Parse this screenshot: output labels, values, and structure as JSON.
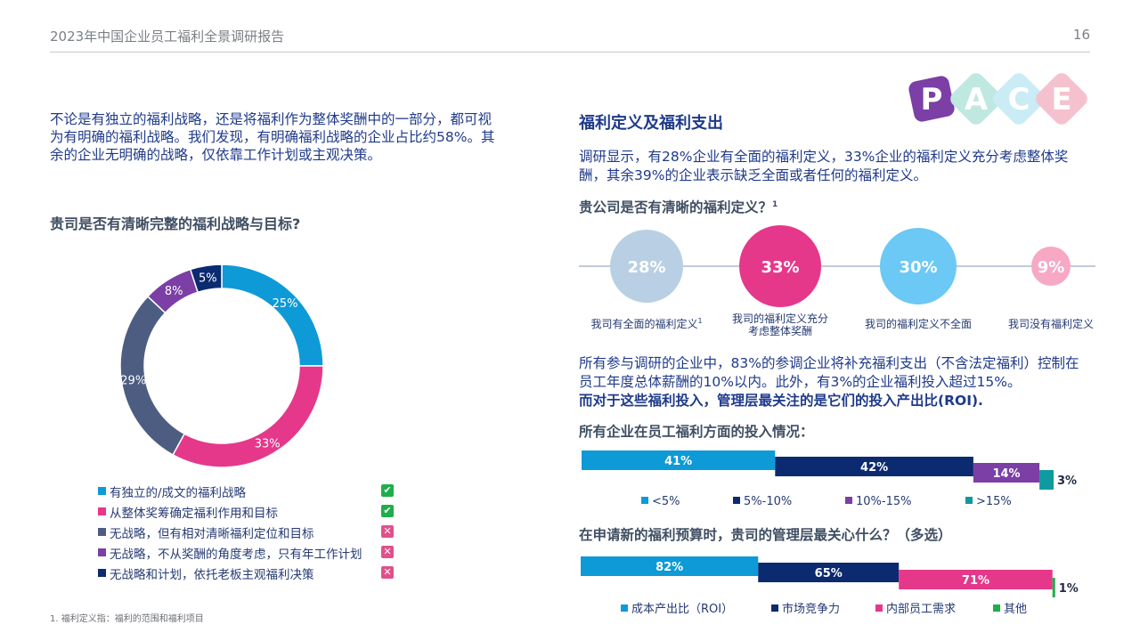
{
  "header": {
    "title": "2023年中国企业员工福利全景调研报告",
    "page": "16"
  },
  "left": {
    "intro": "不论是有独立的福利战略，还是将福利作为整体奖酬中的一部分，都可视为有明确的福利战略。我们发现，有明确福利战略的企业占比约58%。其余的企业无明确的战略，仅依靠工作计划或主观决策。",
    "question": "贵司是否有清晰完整的福利战略与目标?",
    "footnote": "1. 福利定义指：福利的范围和福利项目"
  },
  "pace": {
    "letters": [
      "P",
      "A",
      "C",
      "E"
    ],
    "colors": [
      "#7b3fa6",
      "#bfe8e0",
      "#c9ecf5",
      "#f6c1cf"
    ]
  },
  "right": {
    "heading": "福利定义及福利支出",
    "para1": "调研显示，有28%企业有全面的福利定义，33%企业的福利定义充分考虑整体奖酬，其余39%的企业表示缺乏全面或者任何的福利定义。",
    "q_def": "贵公司是否有清晰的福利定义？",
    "q_def_sup": "1",
    "para2": "所有参与调研的企业中，83%的参调企业将补充福利支出（不含法定福利）控制在员工年度总体薪酬的10%以内。此外，有3%的企业福利投入超过15%。",
    "para2_bold": "而对于这些福利投入，管理层最关注的是它们的投入产出比(ROI).",
    "q_invest": "所有企业在员工福利方面的投入情况：",
    "q_budget": "在申请新的福利预算时，贵司的管理层最关心什么？（多选）"
  },
  "chart_data": [
    {
      "type": "pie",
      "title": "贵司是否有清晰完整的福利战略与目标?",
      "categories": [
        "有独立的/成文的福利战略",
        "从整体奖筹确定福利作用和目标",
        "无战略，但有相对清晰福利定位和目标",
        "无战略，不从奖酬的角度考虑，只有年工作计划",
        "无战略和计划，依托老板主观福利决策"
      ],
      "values": [
        25,
        33,
        29,
        8,
        5
      ],
      "labels": [
        "25%",
        "33%",
        "29%",
        "8%",
        "5%"
      ],
      "colors": [
        "#0e9ad7",
        "#e5388b",
        "#4d5d82",
        "#7b3fa6",
        "#0b2a6f"
      ],
      "has_strategy": [
        true,
        true,
        false,
        false,
        false
      ],
      "donut": true,
      "legend": "bottom"
    },
    {
      "type": "bubble",
      "title": "贵公司是否有清晰的福利定义？",
      "categories": [
        "我司有全面的福利定义",
        "我司的福利定义充分考虑整体奖酬",
        "我司的福利定义不全面",
        "我司没有福利定义"
      ],
      "category_lines": [
        [
          "我司有全面的福利定义"
        ],
        [
          "我司的福利定义充分",
          "考虑整体奖酬"
        ],
        [
          "我司的福利定义不全面"
        ],
        [
          "我司没有福利定义"
        ]
      ],
      "category_sup": [
        "1",
        "",
        "",
        ""
      ],
      "values": [
        28,
        33,
        30,
        9
      ],
      "labels": [
        "28%",
        "33%",
        "30%",
        "9%"
      ],
      "colors": [
        "#b9cfe3",
        "#e5388b",
        "#6cc8f5",
        "#f7a8c4"
      ]
    },
    {
      "type": "bar",
      "stacked": true,
      "orientation": "horizontal",
      "title": "所有企业在员工福利方面的投入情况：",
      "categories": [
        "<5%",
        "5%-10%",
        "10%-15%",
        ">15%"
      ],
      "values": [
        41,
        42,
        14,
        3
      ],
      "labels": [
        "41%",
        "42%",
        "14%",
        "3%"
      ],
      "colors": [
        "#0e9ad7",
        "#0b2a6f",
        "#7b3fa6",
        "#0f9aa0"
      ],
      "legend": "bottom"
    },
    {
      "type": "bar",
      "orientation": "horizontal",
      "title": "在申请新的福利预算时，贵司的管理层最关心什么？（多选）",
      "categories": [
        "成本产出比（ROI）",
        "市场竞争力",
        "内部员工需求",
        "其他"
      ],
      "values": [
        82,
        65,
        71,
        1
      ],
      "labels": [
        "82%",
        "65%",
        "71%",
        "1%"
      ],
      "colors": [
        "#0e9ad7",
        "#0b2a6f",
        "#e5388b",
        "#1fae4b"
      ],
      "legend": "bottom"
    }
  ]
}
